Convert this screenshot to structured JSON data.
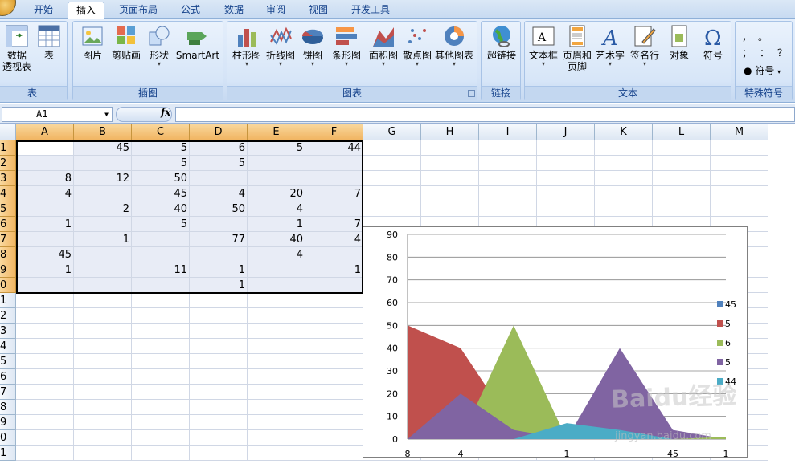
{
  "ribbon": {
    "tabs": [
      "开始",
      "插入",
      "页面布局",
      "公式",
      "数据",
      "审阅",
      "视图",
      "开发工具"
    ],
    "active_tab": "插入",
    "groups": {
      "table": {
        "label": "表",
        "buttons": [
          "数据",
          "透视表",
          "表"
        ]
      },
      "illustrations": {
        "label": "插图",
        "buttons": [
          "图片",
          "剪贴画",
          "形状",
          "SmartArt"
        ]
      },
      "charts": {
        "label": "图表",
        "buttons": [
          "柱形图",
          "折线图",
          "饼图",
          "条形图",
          "面积图",
          "散点图",
          "其他图表"
        ]
      },
      "links": {
        "label": "链接",
        "buttons": [
          "超链接"
        ]
      },
      "text": {
        "label": "文本",
        "buttons": [
          "文本框",
          "页眉和",
          "页脚",
          "艺术字",
          "签名行",
          "对象",
          "符号"
        ]
      },
      "special": {
        "label": "特殊符号",
        "buttons": [
          "符号"
        ],
        "glyphs": [
          "，",
          "。",
          "；",
          "：",
          "？"
        ]
      }
    }
  },
  "formula_bar": {
    "name_box": "A1",
    "fx": "fx",
    "value": ""
  },
  "columns": [
    "A",
    "B",
    "C",
    "D",
    "E",
    "F",
    "G",
    "H",
    "I",
    "J",
    "K",
    "L",
    "M"
  ],
  "rows": [
    "1",
    "2",
    "3",
    "4",
    "5",
    "6",
    "7",
    "8",
    "9",
    "0",
    "1",
    "2",
    "3",
    "4",
    "5",
    "6",
    "7",
    "8",
    "9",
    "0",
    "1"
  ],
  "cells": [
    [
      "",
      "45",
      "5",
      "6",
      "5",
      "44"
    ],
    [
      "",
      "",
      "5",
      "5",
      "",
      ""
    ],
    [
      "8",
      "12",
      "50",
      "",
      "",
      ""
    ],
    [
      "4",
      "",
      "45",
      "4",
      "20",
      "7"
    ],
    [
      "",
      "2",
      "40",
      "50",
      "4",
      ""
    ],
    [
      "1",
      "",
      "5",
      "",
      "1",
      "7"
    ],
    [
      "",
      "1",
      "",
      "77",
      "40",
      "4"
    ],
    [
      "45",
      "",
      "",
      "",
      "4",
      ""
    ],
    [
      "1",
      "",
      "11",
      "1",
      "",
      "1"
    ],
    [
      "",
      "",
      "",
      "1",
      "",
      ""
    ]
  ],
  "chart_data": {
    "type": "area",
    "categories": [
      "8",
      "4",
      "",
      "1",
      "",
      "45",
      "1"
    ],
    "ylim": [
      0,
      90
    ],
    "yticks": [
      0,
      10,
      20,
      30,
      40,
      50,
      60,
      70,
      80,
      90
    ],
    "grid": true,
    "legend_position": "right",
    "series": [
      {
        "name": "45",
        "color": "#4f81bd",
        "values": [
          0,
          0,
          0,
          0,
          0,
          0,
          0
        ]
      },
      {
        "name": "5",
        "color": "#c0504d",
        "values": [
          50,
          40,
          5,
          0,
          0,
          0,
          0
        ]
      },
      {
        "name": "6",
        "color": "#9bbb59",
        "values": [
          0,
          0,
          50,
          0,
          0,
          0,
          0
        ]
      },
      {
        "name": "5",
        "color": "#8064a2",
        "values": [
          0,
          20,
          4,
          0,
          40,
          4,
          0
        ]
      },
      {
        "name": "44",
        "color": "#4bacc6",
        "values": [
          0,
          0,
          0,
          7,
          4,
          0,
          0
        ]
      }
    ],
    "extra_marks": [
      {
        "series": "6",
        "values": [
          0,
          0,
          0,
          0,
          0,
          0,
          1
        ]
      }
    ]
  },
  "watermark": {
    "logo": "Baidu经验",
    "url": "jingyan.baidu.com"
  }
}
